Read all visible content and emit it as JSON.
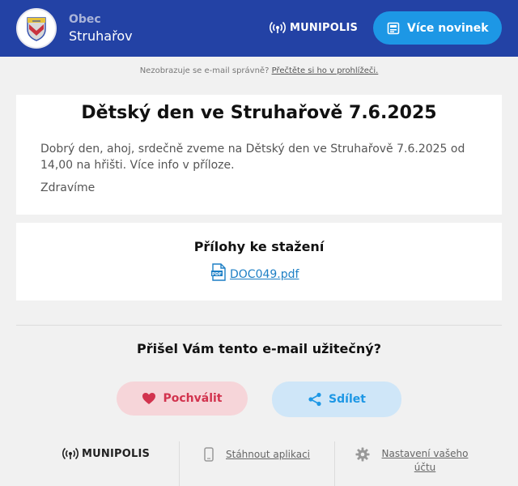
{
  "header": {
    "municipality_kind": "Obec",
    "municipality_name": "Struhařov",
    "brand": "MUNIPOLIS",
    "more_news_label": "Více novinek",
    "colors": {
      "header_bg": "#2342a5",
      "button_bg": "#1d97e5"
    }
  },
  "notice": {
    "text": "Nezobrazuje se e-mail správně?",
    "link": "Přečtěte si ho v prohlížeči."
  },
  "post": {
    "title": "Dětský den ve Struhařově 7.6.2025",
    "body": "Dobrý den, ahoj, srdečně zveme na Dětský den ve Struhařově 7.6.2025 od 14,00 na hřišti. Více info v příloze.",
    "greeting": "Zdravíme"
  },
  "attachments": {
    "title": "Přílohy ke stažení",
    "items": [
      {
        "name": "DOC049.pdf",
        "icon": "pdf-file-icon"
      }
    ]
  },
  "feedback": {
    "question": "Přišel Vám tento e-mail užitečný?",
    "praise_label": "Pochválit",
    "share_label": "Sdílet",
    "colors": {
      "praise": "#d2334e",
      "share": "#1d97e5"
    }
  },
  "footer": {
    "brand": "MUNIPOLIS",
    "download_app": "Stáhnout aplikaci",
    "account_settings": "Nastavení vašeho účtu"
  }
}
